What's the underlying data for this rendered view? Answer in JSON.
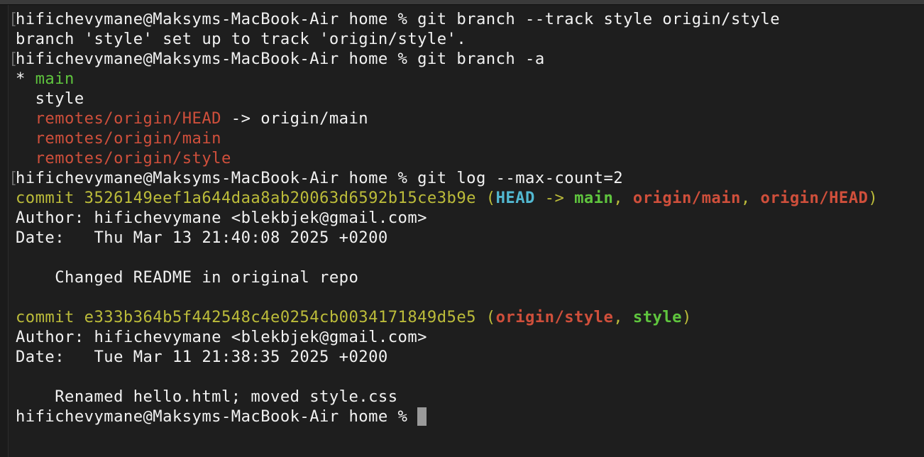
{
  "terminal": {
    "lines": [
      {
        "marked": true,
        "segments": [
          {
            "text": "hifichevymane@Maksyms-MacBook-Air home % git branch --track style origin/style",
            "style": "white"
          }
        ]
      },
      {
        "marked": false,
        "segments": [
          {
            "text": "branch 'style' set up to track 'origin/style'.",
            "style": "white"
          }
        ]
      },
      {
        "marked": true,
        "segments": [
          {
            "text": "hifichevymane@Maksyms-MacBook-Air home % git branch -a",
            "style": "white"
          }
        ]
      },
      {
        "marked": false,
        "segments": [
          {
            "text": "* ",
            "style": "white"
          },
          {
            "text": "main",
            "style": "green"
          }
        ]
      },
      {
        "marked": false,
        "segments": [
          {
            "text": "  style",
            "style": "white"
          }
        ]
      },
      {
        "marked": false,
        "segments": [
          {
            "text": "  ",
            "style": "white"
          },
          {
            "text": "remotes/origin/HEAD",
            "style": "red"
          },
          {
            "text": " -> origin/main",
            "style": "white"
          }
        ]
      },
      {
        "marked": false,
        "segments": [
          {
            "text": "  ",
            "style": "white"
          },
          {
            "text": "remotes/origin/main",
            "style": "red"
          }
        ]
      },
      {
        "marked": false,
        "segments": [
          {
            "text": "  ",
            "style": "white"
          },
          {
            "text": "remotes/origin/style",
            "style": "red"
          }
        ]
      },
      {
        "marked": true,
        "segments": [
          {
            "text": "hifichevymane@Maksyms-MacBook-Air home % git log --max-count=2",
            "style": "white"
          }
        ]
      },
      {
        "marked": false,
        "segments": [
          {
            "text": "commit 3526149eef1a644daa8ab20063d6592b15ce3b9e (",
            "style": "yellow"
          },
          {
            "text": "HEAD",
            "style": "cyan-b"
          },
          {
            "text": " -> ",
            "style": "yellow"
          },
          {
            "text": "main",
            "style": "green-b"
          },
          {
            "text": ", ",
            "style": "yellow"
          },
          {
            "text": "origin/main",
            "style": "red-b"
          },
          {
            "text": ", ",
            "style": "yellow"
          },
          {
            "text": "origin/HEAD",
            "style": "red-b"
          },
          {
            "text": ")",
            "style": "yellow"
          }
        ]
      },
      {
        "marked": false,
        "segments": [
          {
            "text": "Author: hifichevymane <blekbjek@gmail.com>",
            "style": "white"
          }
        ]
      },
      {
        "marked": false,
        "segments": [
          {
            "text": "Date:   Thu Mar 13 21:40:08 2025 +0200",
            "style": "white"
          }
        ]
      },
      {
        "marked": false,
        "segments": [
          {
            "text": "",
            "style": "white"
          }
        ]
      },
      {
        "marked": false,
        "segments": [
          {
            "text": "    Changed README in original repo",
            "style": "white"
          }
        ]
      },
      {
        "marked": false,
        "segments": [
          {
            "text": "",
            "style": "white"
          }
        ]
      },
      {
        "marked": false,
        "segments": [
          {
            "text": "commit e333b364b5f442548c4e0254cb0034171849d5e5 (",
            "style": "yellow"
          },
          {
            "text": "origin/style",
            "style": "red-b"
          },
          {
            "text": ", ",
            "style": "yellow"
          },
          {
            "text": "style",
            "style": "green-b"
          },
          {
            "text": ")",
            "style": "yellow"
          }
        ]
      },
      {
        "marked": false,
        "segments": [
          {
            "text": "Author: hifichevymane <blekbjek@gmail.com>",
            "style": "white"
          }
        ]
      },
      {
        "marked": false,
        "segments": [
          {
            "text": "Date:   Tue Mar 11 21:38:35 2025 +0200",
            "style": "white"
          }
        ]
      },
      {
        "marked": false,
        "segments": [
          {
            "text": "",
            "style": "white"
          }
        ]
      },
      {
        "marked": false,
        "segments": [
          {
            "text": "    Renamed hello.html; moved style.css",
            "style": "white"
          }
        ]
      },
      {
        "marked": false,
        "cursor": true,
        "segments": [
          {
            "text": "hifichevymane@Maksyms-MacBook-Air home % ",
            "style": "white"
          }
        ]
      }
    ],
    "mark_glyph": "["
  }
}
